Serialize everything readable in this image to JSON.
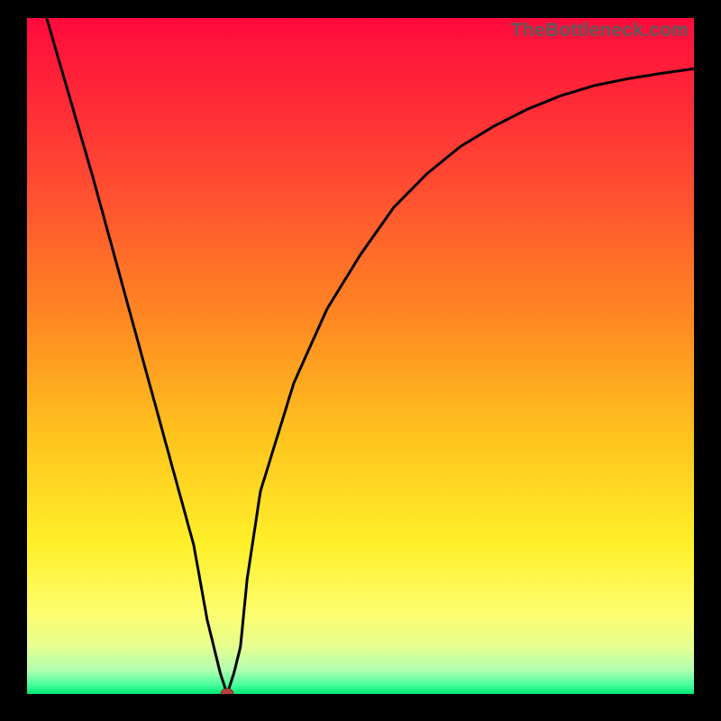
{
  "watermark": "TheBottleneck.com",
  "chart_data": {
    "type": "line",
    "title": "",
    "xlabel": "",
    "ylabel": "",
    "xlim": [
      0,
      100
    ],
    "ylim": [
      0,
      100
    ],
    "x": [
      0,
      5,
      10,
      15,
      20,
      25,
      27,
      29,
      30,
      31,
      32,
      33,
      35,
      40,
      45,
      50,
      55,
      60,
      65,
      70,
      75,
      80,
      85,
      90,
      95,
      100
    ],
    "values": [
      110,
      93,
      76,
      58,
      40,
      22,
      11,
      3,
      0,
      3,
      7,
      17,
      30,
      46,
      57,
      65,
      72,
      77,
      81,
      84,
      86.5,
      88.5,
      90,
      91,
      91.8,
      92.5
    ],
    "marker": {
      "x": 30,
      "y": 0
    },
    "background_gradient": [
      {
        "pos": 0.0,
        "color": "#ff0a3c"
      },
      {
        "pos": 0.22,
        "color": "#ff4433"
      },
      {
        "pos": 0.45,
        "color": "#ff8a22"
      },
      {
        "pos": 0.62,
        "color": "#ffc41e"
      },
      {
        "pos": 0.78,
        "color": "#fff02a"
      },
      {
        "pos": 0.88,
        "color": "#fdfd6e"
      },
      {
        "pos": 0.93,
        "color": "#e6ff90"
      },
      {
        "pos": 0.965,
        "color": "#b0ffb0"
      },
      {
        "pos": 0.985,
        "color": "#4fffa0"
      },
      {
        "pos": 1.0,
        "color": "#00e874"
      }
    ]
  },
  "colors": {
    "curve": "#000000",
    "marker_fill": "#b8403a",
    "marker_stroke": "#7a2a26"
  }
}
